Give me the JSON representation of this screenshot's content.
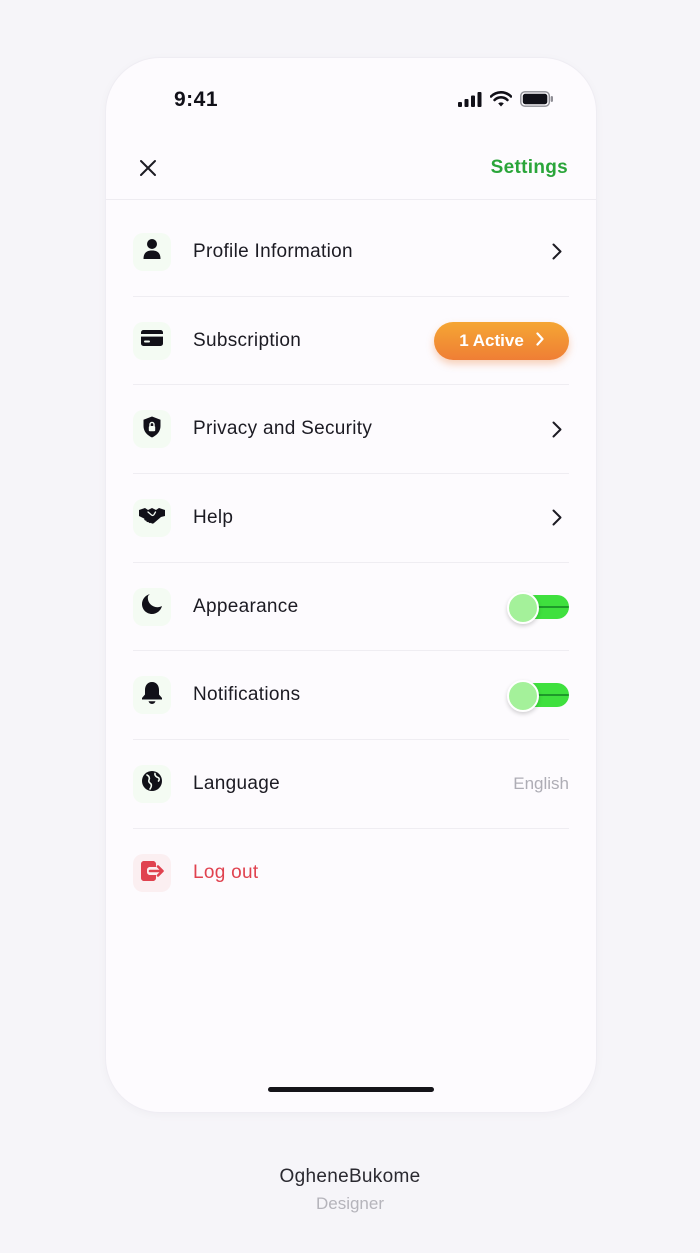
{
  "status_bar": {
    "time": "9:41",
    "icons": [
      "cellular-signal-icon",
      "wifi-icon",
      "battery-icon"
    ]
  },
  "nav": {
    "title": "Settings",
    "close_icon": "close-icon"
  },
  "menu": [
    {
      "id": "profile",
      "label": "Profile Information",
      "icon": "person-icon",
      "trailing": "chevron"
    },
    {
      "id": "subscription",
      "label": "Subscription",
      "icon": "credit-card-icon",
      "trailing": "badge",
      "badge_label": "1 Active"
    },
    {
      "id": "privacy",
      "label": "Privacy and Security",
      "icon": "shield-lock-icon",
      "trailing": "chevron"
    },
    {
      "id": "help",
      "label": "Help",
      "icon": "handshake-icon",
      "trailing": "chevron"
    },
    {
      "id": "appearance",
      "label": "Appearance",
      "icon": "moon-icon",
      "trailing": "toggle",
      "toggle_on": true
    },
    {
      "id": "notifications",
      "label": "Notifications",
      "icon": "bell-icon",
      "trailing": "toggle",
      "toggle_on": true
    },
    {
      "id": "language",
      "label": "Language",
      "icon": "globe-icon",
      "trailing": "value",
      "value": "English"
    },
    {
      "id": "logout",
      "label": "Log out",
      "icon": "logout-icon",
      "trailing": "none"
    }
  ],
  "credit": {
    "name": "OgheneBukome",
    "role": "Designer"
  },
  "colors": {
    "accent_green": "#2aa53a",
    "toggle_green": "#3fe03e",
    "badge_orange": "#f29134",
    "logout_red": "#e0424f"
  }
}
